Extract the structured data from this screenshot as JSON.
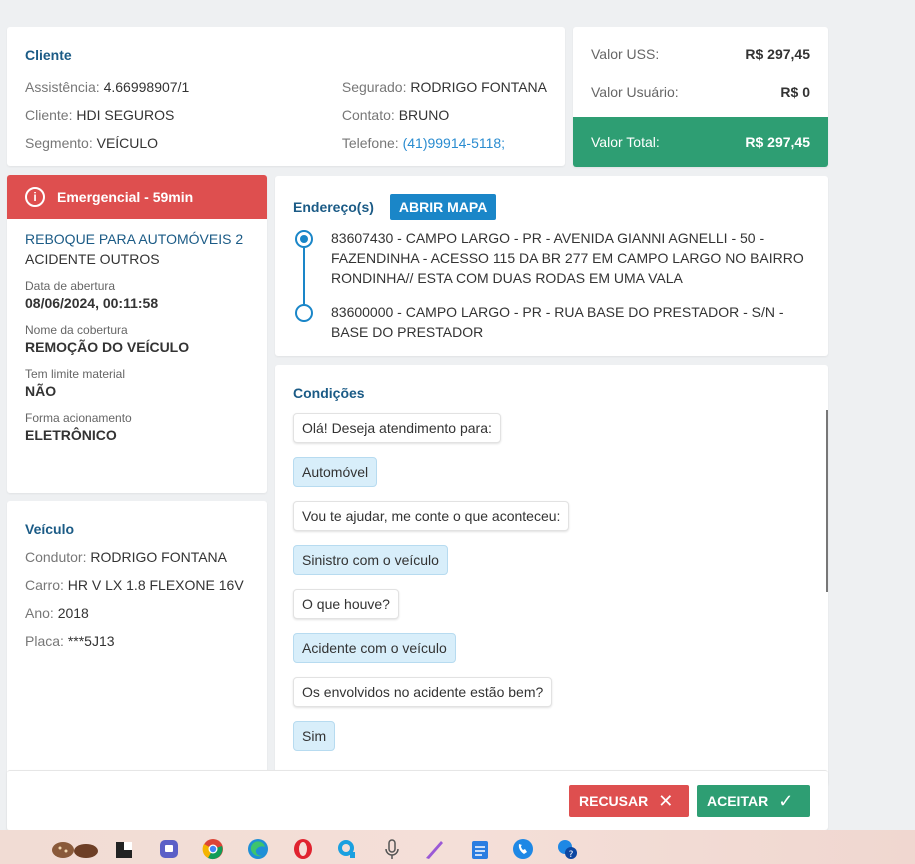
{
  "cliente": {
    "title": "Cliente",
    "left": [
      {
        "label": "Assistência:",
        "value": "4.66998907/1"
      },
      {
        "label": "Cliente:",
        "value": "HDI SEGUROS"
      },
      {
        "label": "Segmento:",
        "value": "VEÍCULO"
      }
    ],
    "right": [
      {
        "label": "Segurado:",
        "value": "RODRIGO FONTANA"
      },
      {
        "label": "Contato:",
        "value": "BRUNO"
      },
      {
        "label": "Telefone:",
        "value": "(41)99914-5118;"
      }
    ]
  },
  "valores": {
    "uss_label": "Valor USS:",
    "uss_value": "R$ 297,45",
    "usuario_label": "Valor Usuário:",
    "usuario_value": "R$ 0",
    "total_label": "Valor Total:",
    "total_value": "R$ 297,45",
    "total_color": "#2e9e73"
  },
  "servico": {
    "banner": "Emergencial - 59min",
    "banner_color": "#de4f4f",
    "title": "REBOQUE PARA AUTOMÓVEIS 2",
    "subtitle": "ACIDENTE OUTROS",
    "fields": [
      {
        "label": "Data de abertura",
        "value": "08/06/2024, 00:11:58"
      },
      {
        "label": "Nome da cobertura",
        "value": "REMOÇÃO DO VEÍCULO"
      },
      {
        "label": "Tem limite material",
        "value": "NÃO"
      },
      {
        "label": "Forma acionamento",
        "value": "ELETRÔNICO"
      }
    ]
  },
  "veiculo": {
    "title": "Veículo",
    "rows": [
      {
        "label": "Condutor:",
        "value": "RODRIGO FONTANA"
      },
      {
        "label": "Carro:",
        "value": "HR V LX 1.8 FLEXONE 16V"
      },
      {
        "label": "Ano:",
        "value": "2018"
      },
      {
        "label": "Placa:",
        "value": "***5J13"
      }
    ]
  },
  "enderecos": {
    "title": "Endereço(s)",
    "map_button": "ABRIR MAPA",
    "items": [
      "83607430 - CAMPO LARGO - PR - AVENIDA GIANNI AGNELLI - 50 - FAZENDINHA - ACESSO 115 DA BR 277 EM CAMPO LARGO NO BAIRRO RONDINHA// ESTA COM DUAS RODAS EM UMA VALA",
      "83600000 - CAMPO LARGO - PR - RUA BASE DO PRESTADOR - S/N - BASE DO PRESTADOR"
    ]
  },
  "condicoes": {
    "title": "Condições",
    "messages": [
      {
        "type": "q",
        "text": "Olá! Deseja atendimento para:"
      },
      {
        "type": "a",
        "text": "Automóvel"
      },
      {
        "type": "q",
        "text": "Vou te ajudar, me conte o que aconteceu:"
      },
      {
        "type": "a",
        "text": "Sinistro com o veículo"
      },
      {
        "type": "q",
        "text": "O que houve?"
      },
      {
        "type": "a",
        "text": "Acidente com o veículo"
      },
      {
        "type": "q",
        "text": "Os envolvidos no acidente estão bem?"
      },
      {
        "type": "a",
        "text": "Sim"
      }
    ]
  },
  "footer": {
    "recusar": "RECUSAR",
    "aceitar": "ACEITAR"
  },
  "taskbar": {
    "icons": [
      "cookies-icon",
      "terminal-icon",
      "chat-app-icon",
      "chrome-icon",
      "edge-icon",
      "opera-icon",
      "search-app-icon",
      "microphone-icon",
      "pen-icon",
      "notepad-icon",
      "phone-icon",
      "help-icon"
    ]
  }
}
